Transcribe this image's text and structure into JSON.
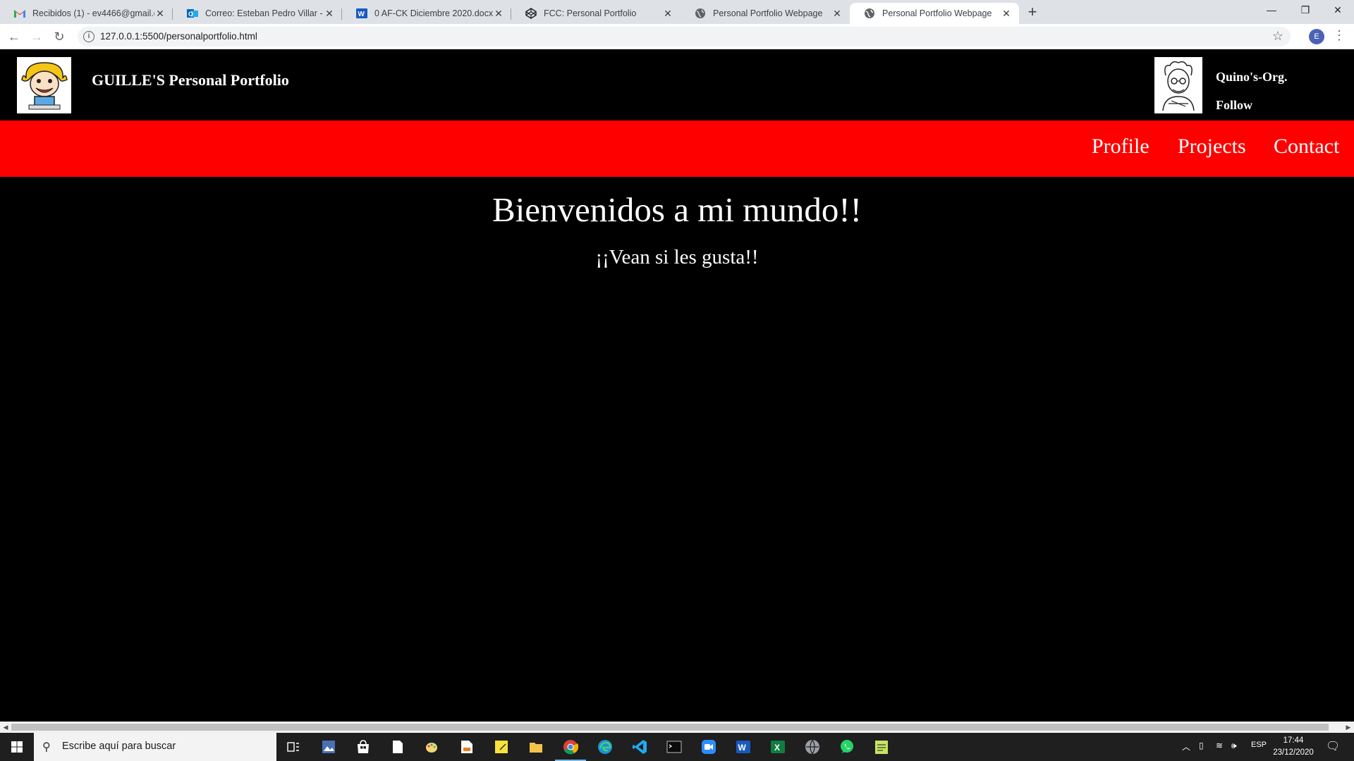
{
  "browser": {
    "tabs": [
      {
        "title": "Recibidos (1) - ev4466@gmail.co",
        "icon": "gmail-icon"
      },
      {
        "title": "Correo: Esteban Pedro Villar - Ou",
        "icon": "outlook-icon"
      },
      {
        "title": "0 AF-CK Diciembre 2020.docx - M",
        "icon": "word-icon"
      },
      {
        "title": "FCC: Personal Portfolio",
        "icon": "codepen-icon"
      },
      {
        "title": "Personal Portfolio Webpage",
        "icon": "globe-icon"
      },
      {
        "title": "Personal Portfolio Webpage",
        "icon": "globe-icon",
        "active": true
      }
    ],
    "url": "127.0.0.1:5500/personalportfolio.html",
    "profile_initial": "E"
  },
  "header": {
    "title": "GUILLE'S Personal Portfolio",
    "sponsor_name": "Quino's-Org.",
    "follow_label": "Follow"
  },
  "nav": {
    "profile": "Profile",
    "projects": "Projects",
    "contact": "Contact"
  },
  "main": {
    "heading": "Bienvenidos a mi mundo!!",
    "subheading": "¡¡Vean si les gusta!!"
  },
  "taskbar": {
    "search_placeholder": "Escribe aquí para buscar",
    "language": "ESP",
    "time": "17:44",
    "date": "23/12/2020"
  },
  "colors": {
    "nav_background": "#ff0000",
    "page_background": "#000000",
    "text": "#ffffff"
  }
}
